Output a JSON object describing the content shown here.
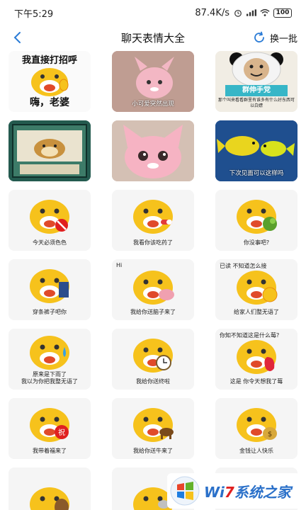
{
  "status_bar": {
    "time": "下午5:29",
    "network_speed": "87.4K/s",
    "battery": "100"
  },
  "nav": {
    "title": "聊天表情大全",
    "refresh_label": "换一批"
  },
  "tiles": [
    {
      "top": "我直接打招呼",
      "bottom": "嗨，老婆"
    },
    {
      "caption": "小可爱突然出现"
    },
    {
      "banner": "群伸手党",
      "sub": "那个叫来看看群里有谁多有什么好东西可以白嫖"
    },
    {
      "top": ""
    },
    {},
    {
      "caption": "下次见面可以这样吗"
    },
    {
      "caption": "今天必须色色"
    },
    {
      "caption": "我看你该吃药了"
    },
    {
      "caption": "你没事吧?"
    },
    {
      "caption": "穿条裤子吧你"
    },
    {
      "caption_top": "Hi",
      "caption": "我给你送脑子来了"
    },
    {
      "caption_top": "已读 不知道怎么接",
      "caption": "给家人们整无语了"
    },
    {
      "caption": "原来是下雨了\n我以为你把我整无语了"
    },
    {
      "caption": "我给你送终啦"
    },
    {
      "caption_top": "你知不知道这是什么莓?",
      "caption": "这是 你令天想我了莓"
    },
    {
      "caption": "我带着福来了",
      "badge": "祝"
    },
    {
      "caption": "我给你送牛来了"
    },
    {
      "caption": "金钱让人快乐"
    },
    {},
    {},
    {}
  ],
  "watermark": {
    "text_blue_1": "Wi",
    "text_red": "7",
    "text_blue_2": "系统之家"
  },
  "colors": {
    "accent": "#2a7bd6",
    "emoji_yellow": "#f6c21c",
    "emoji_orange": "#e8890c"
  }
}
